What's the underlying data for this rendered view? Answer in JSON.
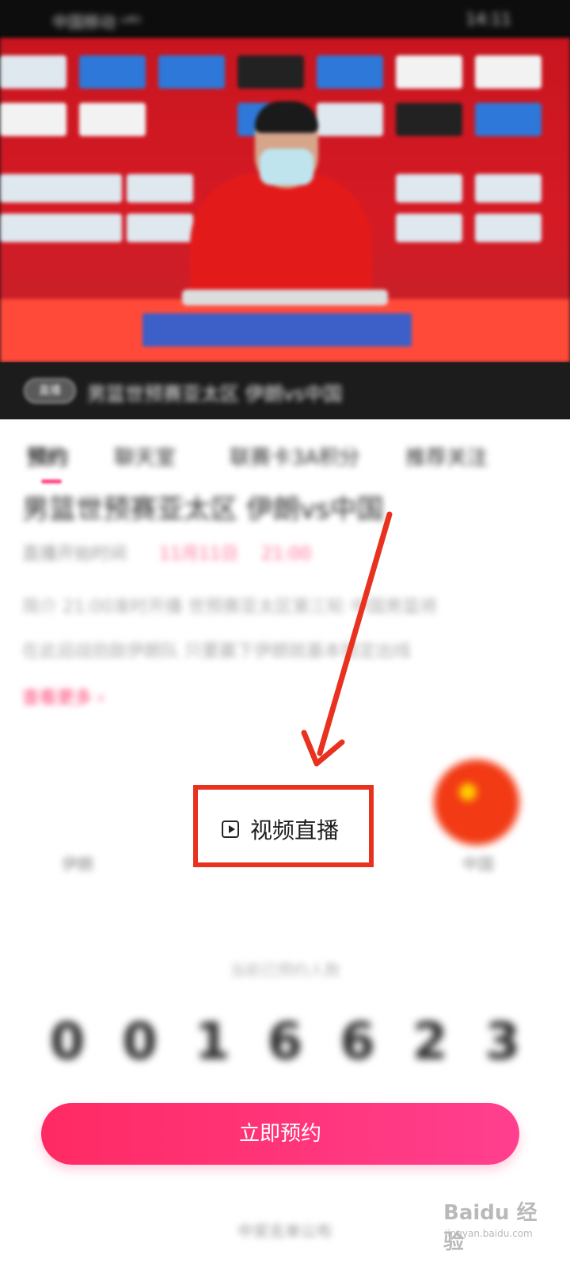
{
  "status_bar": {
    "carrier": "中国移动 ᵘ⁴ᴳ",
    "time": "14:11"
  },
  "video": {
    "live_tag": "直播",
    "caption": "男篮世预赛亚太区 伊朗vs中国"
  },
  "tabs": [
    "预约",
    "聊天室",
    "联赛卡3A积分",
    "推荐关注"
  ],
  "event": {
    "title": "男篮世预赛亚太区 伊朗vs中国",
    "start_label": "直播开始时间",
    "start_date": "11月11日",
    "start_time": "21:00",
    "intro_line1": "简介  21:00准时开播  世预赛亚太区第三轮  中国男篮将",
    "intro_line2": "在此迎战劲敌伊朗队  只要赢下伊朗就基本锁定出线",
    "view_more": "查看更多 ›"
  },
  "teams": {
    "home": "伊朗",
    "away": "中国"
  },
  "live_button": {
    "label": "视频直播"
  },
  "reservation": {
    "count_label": "当前已预约人数",
    "digits": [
      "0",
      "0",
      "1",
      "6",
      "6",
      "2",
      "3"
    ],
    "button_label": "立即预约",
    "footer": "中奖名单公布"
  },
  "watermark": {
    "brand": "Baidu 经验",
    "url": "jingyan.baidu.com"
  },
  "colors": {
    "accent": "#ff3b7f",
    "highlight_box": "#e8321f",
    "annotation_arrow": "#e8321f"
  }
}
